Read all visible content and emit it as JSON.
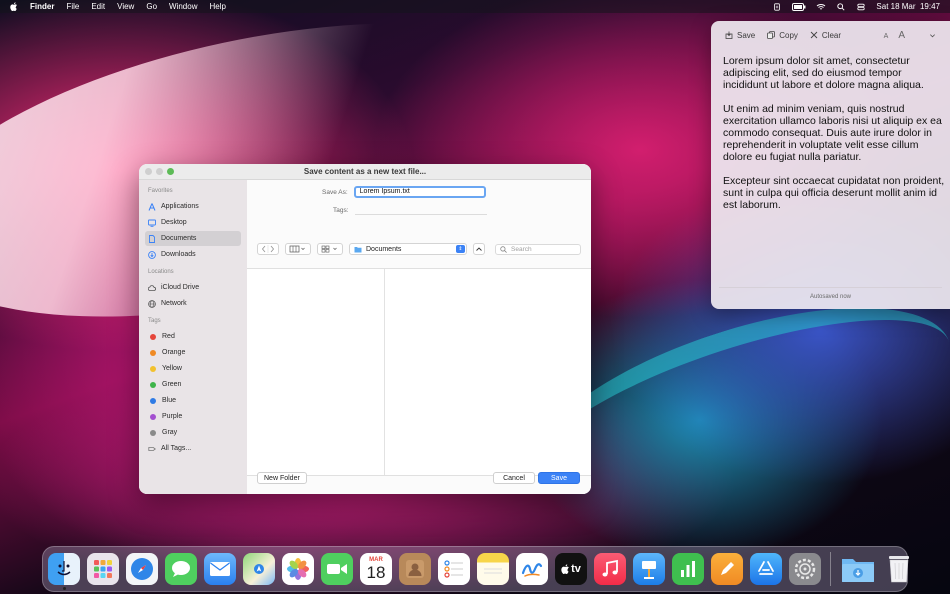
{
  "menubar": {
    "app_name": "Finder",
    "items": [
      "File",
      "Edit",
      "View",
      "Go",
      "Window",
      "Help"
    ],
    "clock": "Sat 18 Mar  19:47",
    "status_icons": [
      "notes-icon",
      "battery-icon",
      "wifi-icon",
      "search-icon",
      "control-center-icon"
    ]
  },
  "notes": {
    "toolbar": {
      "save": "Save",
      "copy": "Copy",
      "clear": "Clear",
      "font_small": "A",
      "font_large": "A"
    },
    "text": "Lorem ipsum dolor sit amet, consectetur adipiscing elit, sed do eiusmod tempor incididunt ut labore et dolore magna aliqua.\n\nUt enim ad minim veniam, quis nostrud exercitation ullamco laboris nisi ut aliquip ex ea commodo consequat. Duis aute irure dolor in reprehenderit in voluptate velit esse cillum dolore eu fugiat nulla pariatur.\n\nExcepteur sint occaecat cupidatat non proident, sunt in culpa qui officia deserunt mollit anim id est laborum.",
    "footer": "Autosaved now"
  },
  "dialog": {
    "title": "Save content as a new text file...",
    "save_as_label": "Save As:",
    "save_as_value": "Lorem Ipsum.txt",
    "tags_label": "Tags:",
    "location": "Documents",
    "search_placeholder": "Search",
    "new_folder": "New Folder",
    "cancel": "Cancel",
    "save": "Save",
    "sidebar": {
      "favorites_label": "Favorites",
      "favorites": [
        "Applications",
        "Desktop",
        "Documents",
        "Downloads"
      ],
      "locations_label": "Locations",
      "locations": [
        "iCloud Drive",
        "Network"
      ],
      "tags_label": "Tags",
      "tags": [
        {
          "name": "Red",
          "color": "#e5453a"
        },
        {
          "name": "Orange",
          "color": "#f08a24"
        },
        {
          "name": "Yellow",
          "color": "#f2c12e"
        },
        {
          "name": "Green",
          "color": "#3fb44a"
        },
        {
          "name": "Blue",
          "color": "#2f7be5"
        },
        {
          "name": "Purple",
          "color": "#a34fd0"
        },
        {
          "name": "Gray",
          "color": "#8a8a8a"
        }
      ],
      "all_tags": "All Tags..."
    }
  },
  "dock": {
    "calendar_month": "MAR",
    "calendar_day": "18",
    "tv_label": "tv",
    "apps": [
      "finder",
      "launchpad",
      "safari",
      "messages",
      "mail",
      "maps",
      "photos",
      "facetime",
      "calendar",
      "contacts",
      "reminders",
      "notes",
      "freeform",
      "tv",
      "music",
      "keynote",
      "numbers",
      "pages",
      "app-store",
      "system-settings",
      "downloads",
      "trash"
    ]
  }
}
